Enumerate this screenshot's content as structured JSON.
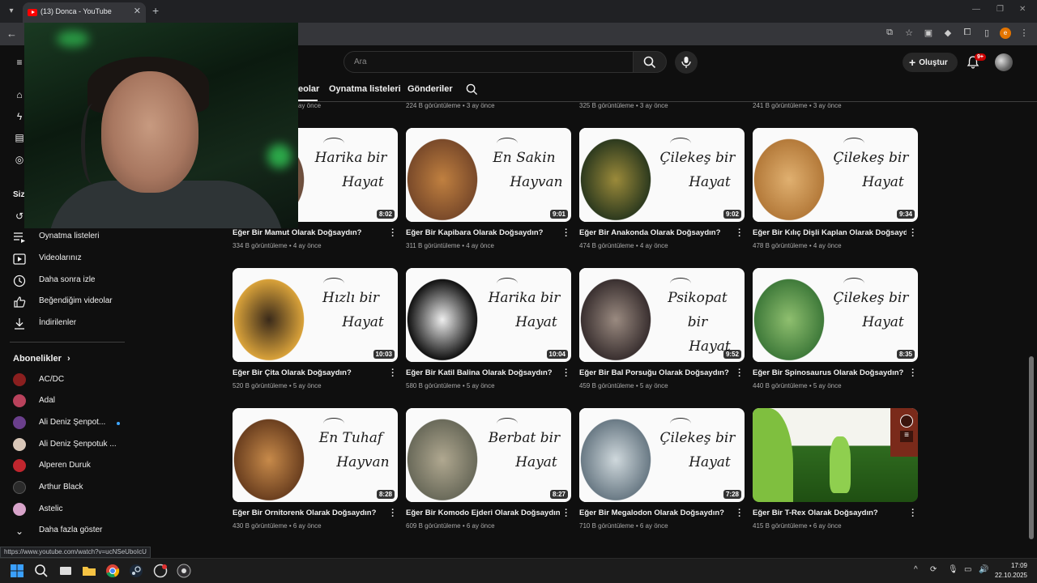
{
  "browser": {
    "tab_title": "(13) Donca - YouTube",
    "status_url": "https://www.youtube.com/watch?v=ucNSeUboIcU"
  },
  "header": {
    "search_placeholder": "Ara",
    "create_label": "Oluştur",
    "notification_count": "9+"
  },
  "channel_tabs": [
    "eolar",
    "Oynatma listeleri",
    "Gönderiler"
  ],
  "sidebar": {
    "partial_heading": "Siz",
    "items": [
      {
        "label": "Oynatma listeleri",
        "icon": "playlist-icon"
      },
      {
        "label": "Videolarınız",
        "icon": "video-icon"
      },
      {
        "label": "Daha sonra izle",
        "icon": "clock-icon"
      },
      {
        "label": "Beğendiğim videolar",
        "icon": "thumbs-up-icon"
      },
      {
        "label": "İndirilenler",
        "icon": "download-icon"
      }
    ],
    "subscriptions_title": "Abonelikler",
    "subscriptions": [
      {
        "label": "AC/DC",
        "color": "#8a1f1f"
      },
      {
        "label": "Adal",
        "color": "#b9425c"
      },
      {
        "label": "Ali Deniz Şenpot...",
        "color": "#6a3f8c",
        "live": true
      },
      {
        "label": "Ali Deniz Şenpotuk ...",
        "color": "#d9c7b8"
      },
      {
        "label": "Alperen Duruk",
        "color": "#c0262e"
      },
      {
        "label": "Arthur Black",
        "color": "#2b2b2b"
      },
      {
        "label": "Astelic",
        "color": "#d7a3c9"
      }
    ],
    "show_more": "Daha fazla göster"
  },
  "previous_row_meta": [
    "ay önce",
    "224 B görüntüleme • 3 ay önce",
    "325 B görüntüleme • 3 ay önce",
    "241 B görüntüleme • 3 ay önce"
  ],
  "videos": [
    {
      "title": "Eğer Bir Mamut Olarak Doğsaydın?",
      "meta": "334 B görüntüleme • 4 ay önce",
      "duration": "8:02",
      "thumb_line1": "Harika bir",
      "thumb_line2": "Hayat"
    },
    {
      "title": "Eğer Bir Kapibara Olarak Doğsaydın?",
      "meta": "311 B görüntüleme • 4 ay önce",
      "duration": "9:01",
      "thumb_line1": "En Sakin",
      "thumb_line2": "Hayvan"
    },
    {
      "title": "Eğer Bir Anakonda Olarak Doğsaydın?",
      "meta": "474 B görüntüleme • 4 ay önce",
      "duration": "9:02",
      "thumb_line1": "Çilekeş bir",
      "thumb_line2": "Hayat"
    },
    {
      "title": "Eğer Bir Kılıç Dişli Kaplan Olarak Doğsaydın?",
      "meta": "478 B görüntüleme • 4 ay önce",
      "duration": "9:34",
      "thumb_line1": "Çilekeş bir",
      "thumb_line2": "Hayat"
    },
    {
      "title": "Eğer Bir Çita Olarak Doğsaydın?",
      "meta": "520 B görüntüleme • 5 ay önce",
      "duration": "10:03",
      "thumb_line1": "Hızlı bir",
      "thumb_line2": "Hayat"
    },
    {
      "title": "Eğer Bir Katil Balina Olarak Doğsaydın?",
      "meta": "580 B görüntüleme • 5 ay önce",
      "duration": "10:04",
      "thumb_line1": "Harika bir",
      "thumb_line2": "Hayat"
    },
    {
      "title": "Eğer Bir Bal Porsuğu Olarak Doğsaydın?",
      "meta": "459 B görüntüleme • 5 ay önce",
      "duration": "9:52",
      "thumb_line1": "Psikopat bir",
      "thumb_line2": "Hayat"
    },
    {
      "title": "Eğer Bir Spinosaurus Olarak Doğsaydın?",
      "meta": "440 B görüntüleme • 5 ay önce",
      "duration": "8:35",
      "thumb_line1": "Çilekeş bir",
      "thumb_line2": "Hayat"
    },
    {
      "title": "Eğer Bir Ornitorenk Olarak Doğsaydın?",
      "meta": "430 B görüntüleme • 6 ay önce",
      "duration": "8:28",
      "thumb_line1": "En Tuhaf",
      "thumb_line2": "Hayvan"
    },
    {
      "title": "Eğer Bir Komodo Ejderi Olarak Doğsaydın?",
      "meta": "609 B görüntüleme • 6 ay önce",
      "duration": "8:27",
      "thumb_line1": "Berbat bir",
      "thumb_line2": "Hayat"
    },
    {
      "title": "Eğer Bir Megalodon Olarak Doğsaydın?",
      "meta": "710 B görüntüleme • 6 ay önce",
      "duration": "7:28",
      "thumb_line1": "Çilekeş bir",
      "thumb_line2": "Hayat"
    },
    {
      "title": "Eğer Bir T-Rex Olarak Doğsaydın?",
      "meta": "415 B görüntüleme • 6 ay önce",
      "duration": "",
      "thumb_line1": "",
      "thumb_line2": ""
    }
  ],
  "taskbar": {
    "time": "17:09",
    "date": "22.10.2025"
  }
}
